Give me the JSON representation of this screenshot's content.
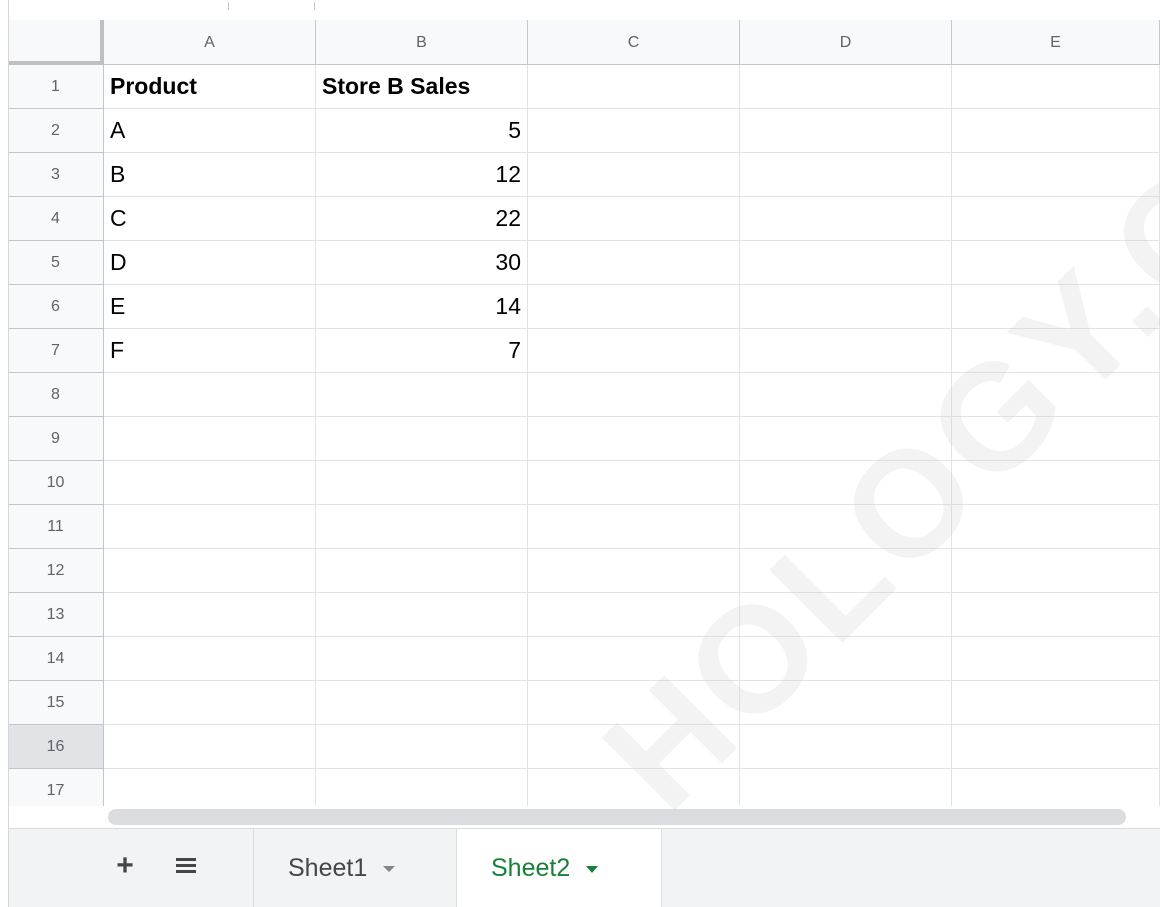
{
  "columns": [
    "A",
    "B",
    "C",
    "D",
    "E"
  ],
  "rows": [
    "1",
    "2",
    "3",
    "4",
    "5",
    "6",
    "7",
    "8",
    "9",
    "10",
    "11",
    "12",
    "13",
    "14",
    "15",
    "16",
    "17"
  ],
  "cells": {
    "A1": "Product",
    "B1": "Store B Sales",
    "A2": "A",
    "B2": "5",
    "A3": "B",
    "B3": "12",
    "A4": "C",
    "B4": "22",
    "A5": "D",
    "B5": "30",
    "A6": "E",
    "B6": "14",
    "A7": "F",
    "B7": "7"
  },
  "selected_row": "16",
  "sheet_bar": {
    "add_label": "+",
    "tabs": [
      {
        "label": "Sheet1",
        "active": false
      },
      {
        "label": "Sheet2",
        "active": true
      }
    ],
    "active_color": "#188038"
  },
  "watermark": {
    "text": "HOLOGY.COM"
  }
}
